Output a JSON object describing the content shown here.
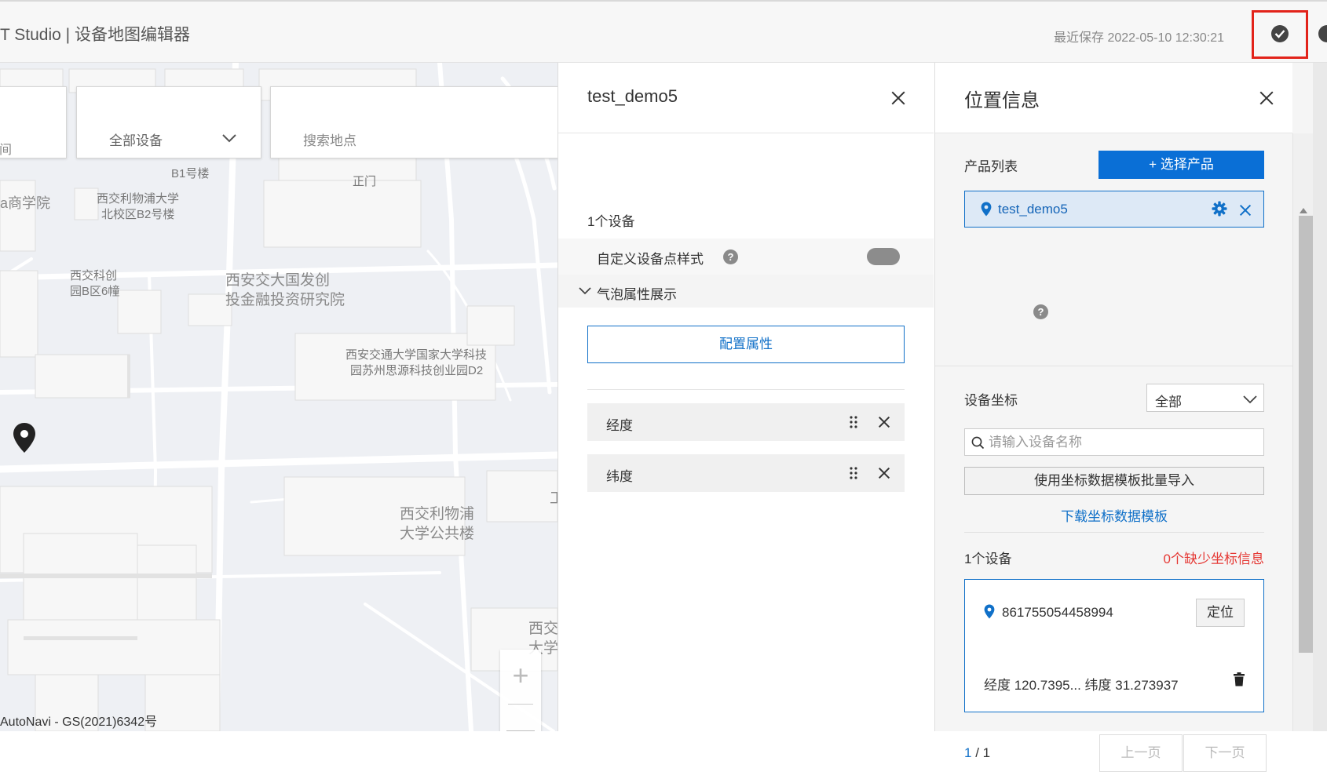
{
  "header": {
    "title": "T Studio | 设备地图编辑器",
    "save_time": "最近保存 2022-05-10 12:30:21"
  },
  "map": {
    "filter_left": "间",
    "device_filter": "全部设备",
    "search_placeholder": "搜索地点",
    "labels": {
      "b1": "B1号楼",
      "gate": "正门",
      "business_school": "a商学院",
      "b2_line1": "西交利物浦大学",
      "b2_line2": "北校区B2号楼",
      "kechuang_line1": "西交科创",
      "kechuang_line2": "园B区6幢",
      "dafa_line1": "西安交大国发创",
      "dafa_line2": "投金融投资研究院",
      "d2_line1": "西安交通大学国家大学科技",
      "d2_line2": "园苏州思源科技创业园D2",
      "public_line1": "西交利物浦",
      "public_line2": "大学公共楼",
      "edge1": "工",
      "edge2_line1": "西交",
      "edge2_line2": "大学"
    },
    "zoom_in": "+",
    "zoom_out": "—",
    "copyright": "AutoNavi - GS(2021)6342号"
  },
  "middle": {
    "name": "test_demo5",
    "device_count": "1个设备",
    "custom_style_label": "自定义设备点样式",
    "bubble_label": "气泡属性展示",
    "configure_btn": "配置属性",
    "attributes": [
      "经度",
      "纬度"
    ]
  },
  "right": {
    "title": "位置信息",
    "product_list_label": "产品列表",
    "select_product_btn": "+ 选择产品",
    "product_item": "test_demo5",
    "coord_label": "设备坐标",
    "coord_select": "全部",
    "search_placeholder": "请输入设备名称",
    "import_btn": "使用坐标数据模板批量导入",
    "download_link": "下载坐标数据模板",
    "device_count": "1个设备",
    "missing_info": "0个缺少坐标信息",
    "device": {
      "id": "861755054458994",
      "locate_btn": "定位",
      "coords": "经度 120.7395...   纬度 31.273937"
    },
    "pager": {
      "current": "1",
      "total": "/ 1"
    },
    "prev_btn": "上一页",
    "next_btn": "下一页"
  },
  "colors": {
    "primary": "#0a6fd6",
    "link": "#1070c8",
    "danger": "#e53935",
    "highlight_border": "#e2231a"
  }
}
